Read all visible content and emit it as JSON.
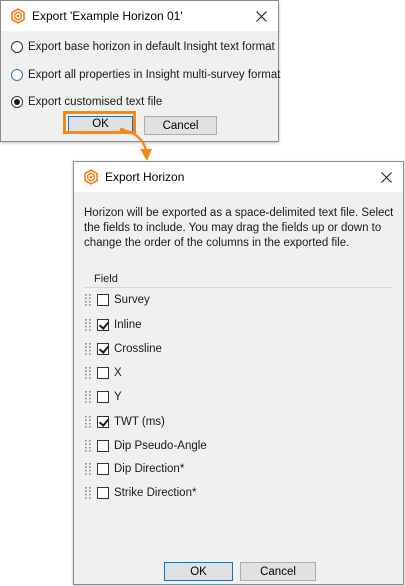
{
  "dialog1": {
    "title": "Export 'Example Horizon 01'",
    "options": [
      {
        "label": "Export base horizon in default Insight text format",
        "selected": false
      },
      {
        "label": "Export all properties in Insight multi-survey format",
        "selected": false
      },
      {
        "label": "Export customised text file",
        "selected": true
      }
    ],
    "ok_label": "OK",
    "cancel_label": "Cancel"
  },
  "dialog2": {
    "title": "Export Horizon",
    "description": "Horizon will be exported as a space-delimited text file. Select the fields to include. You may drag the fields up or down to change the order of the columns in the exported file.",
    "field_header": "Field",
    "fields": [
      {
        "label": "Survey",
        "checked": false
      },
      {
        "label": "Inline",
        "checked": true
      },
      {
        "label": "Crossline",
        "checked": true
      },
      {
        "label": "X",
        "checked": false
      },
      {
        "label": "Y",
        "checked": false
      },
      {
        "label": "TWT (ms)",
        "checked": true
      },
      {
        "label": "Dip Pseudo-Angle",
        "checked": false
      },
      {
        "label": "Dip Direction*",
        "checked": false
      },
      {
        "label": "Strike Direction*",
        "checked": false
      }
    ],
    "ok_label": "OK",
    "cancel_label": "Cancel"
  },
  "colors": {
    "highlight": "#ef8b1e",
    "app_icon": "#e8831f",
    "default_button_border": "#0078d7"
  },
  "icons": {
    "app": "insight-app-icon",
    "close": "close-icon",
    "drag": "drag-handle-icon"
  }
}
